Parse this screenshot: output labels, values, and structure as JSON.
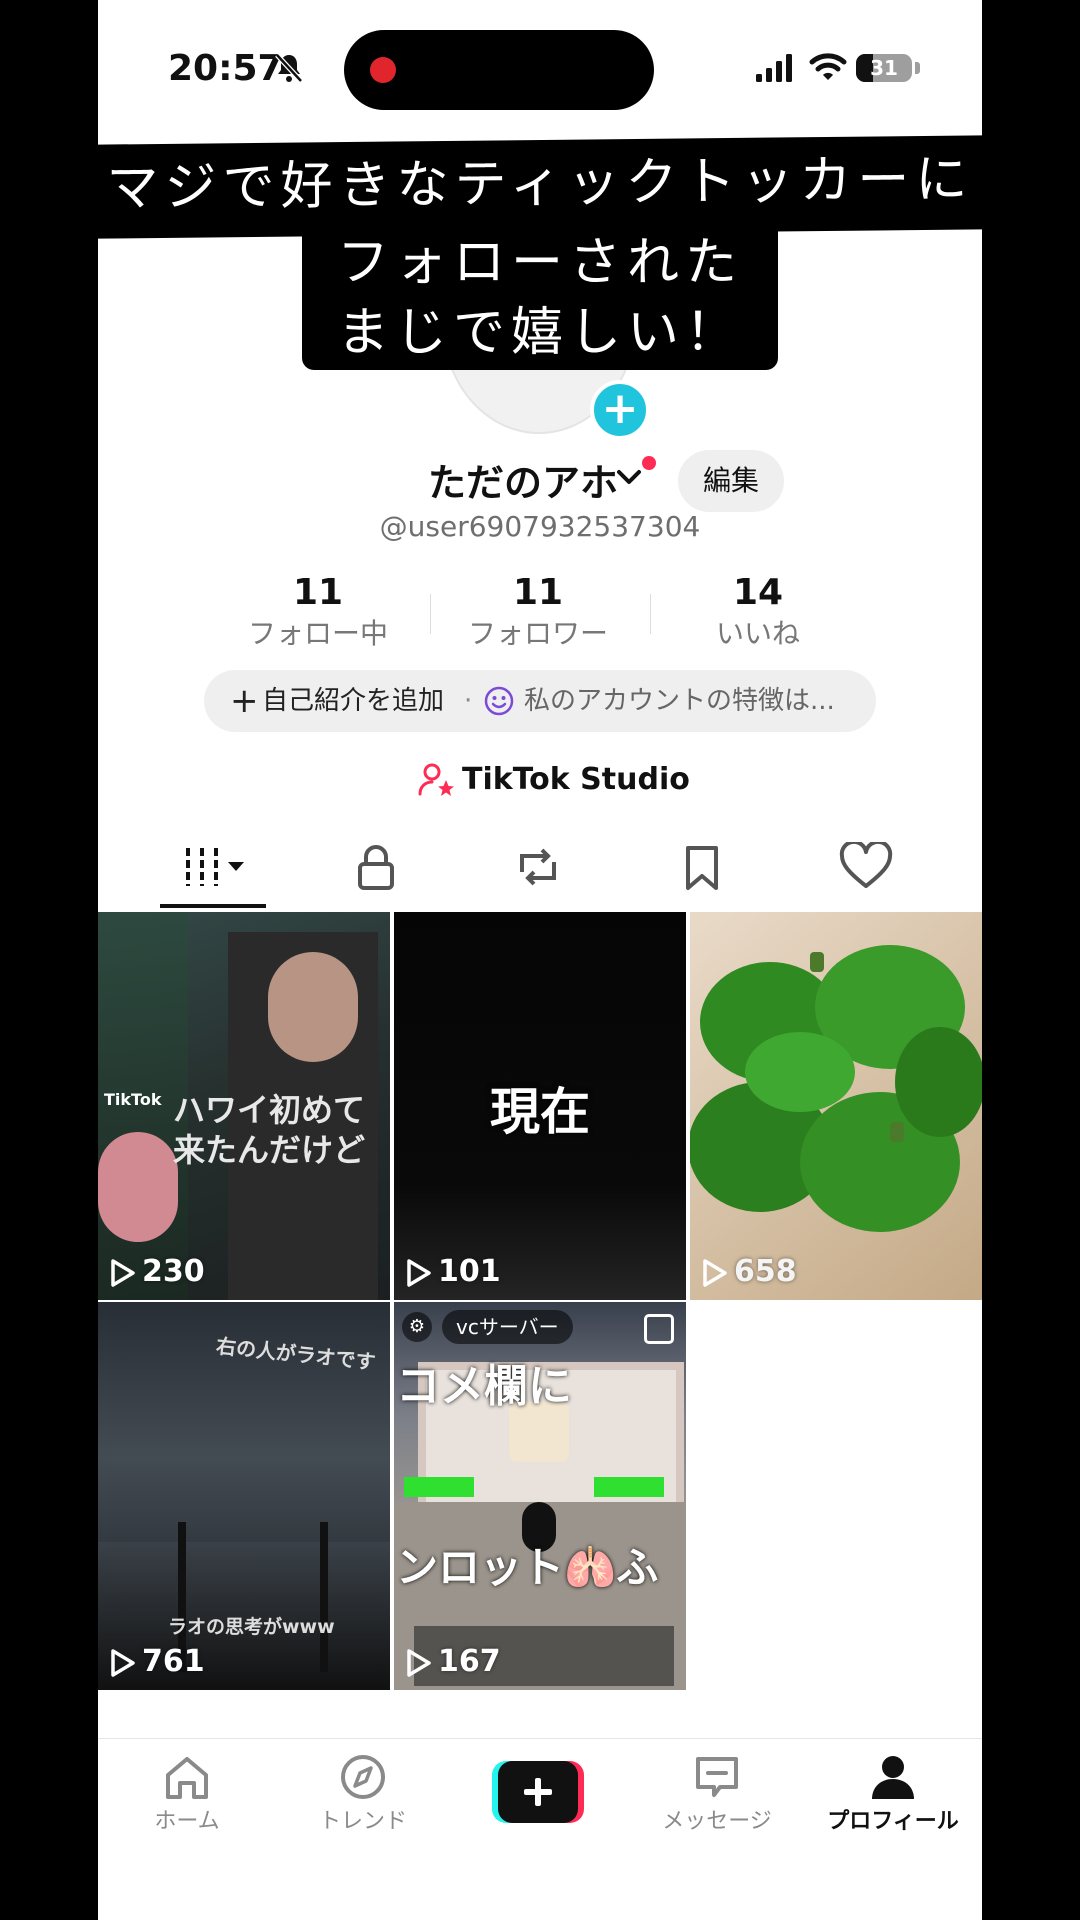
{
  "status_bar": {
    "time": "20:57",
    "battery": "31",
    "battery_level": 0.31
  },
  "caption": {
    "line1": "マジで好きなティックトッカーに",
    "line2": "フォローされた",
    "line3": "まじで嬉しい！"
  },
  "profile": {
    "name": "ただのアホ",
    "edit_label": "編集",
    "handle": "@user6907932537304",
    "stats": [
      {
        "value": "11",
        "label": "フォロー中"
      },
      {
        "value": "11",
        "label": "フォロワー"
      },
      {
        "value": "14",
        "label": "いいね"
      }
    ],
    "bio_add": "自己紹介を追加",
    "bio_separator": "·",
    "bio_hint": "私のアカウントの特徴は...",
    "studio_label": "TikTok Studio"
  },
  "tabs": [
    "videos-icon",
    "lock-icon",
    "repost-icon",
    "bookmark-icon",
    "heart-icon"
  ],
  "videos": [
    {
      "views": "230",
      "text": "ハワイ初めて 来たんだけど",
      "watermark": "TikTok"
    },
    {
      "views": "101",
      "text": "現在"
    },
    {
      "views": "658"
    },
    {
      "views": "761",
      "text_top": "右の人がラオです",
      "text_bottom": "ラオの思考がwww"
    },
    {
      "views": "167",
      "tag": "vcサーバー",
      "text_top": "コメ欄に",
      "text_bottom": "ンロット🫁ふ"
    }
  ],
  "nav": [
    {
      "label": "ホーム",
      "icon": "home-icon"
    },
    {
      "label": "トレンド",
      "icon": "compass-icon"
    },
    {
      "label": "",
      "icon": "plus-icon"
    },
    {
      "label": "メッセージ",
      "icon": "message-icon"
    },
    {
      "label": "プロフィール",
      "icon": "profile-icon"
    }
  ],
  "colors": {
    "accent": "#fe2c55",
    "cyan": "#20c5dd",
    "text": "#111111",
    "muted": "#777777"
  }
}
